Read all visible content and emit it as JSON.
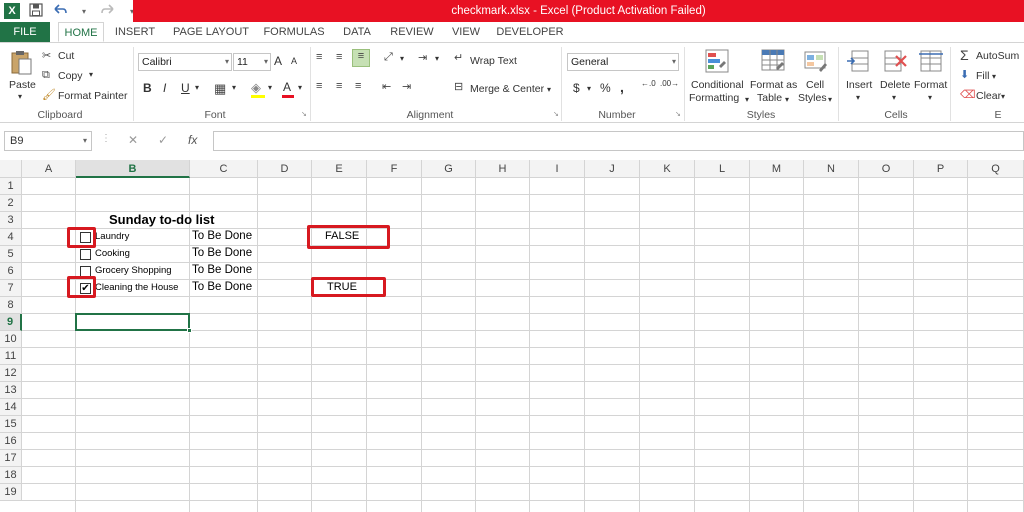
{
  "window": {
    "title": "checkmark.xlsx -  Excel (Product Activation Failed)",
    "accent": "#217346",
    "titlebar_color": "#e81123"
  },
  "qat": {
    "app_icon": "X",
    "save_icon": "save-icon",
    "undo_icon": "undo-icon",
    "redo_icon": "redo-icon",
    "customize_icon": "customize-icon"
  },
  "tabs": [
    "FILE",
    "HOME",
    "INSERT",
    "PAGE LAYOUT",
    "FORMULAS",
    "DATA",
    "REVIEW",
    "VIEW",
    "DEVELOPER"
  ],
  "ribbon": {
    "clipboard": {
      "paste": "Paste",
      "cut": "Cut",
      "copy": "Copy",
      "format_painter": "Format Painter",
      "label": "Clipboard"
    },
    "font": {
      "name": "Calibri",
      "size": "11",
      "bold": "B",
      "italic": "I",
      "underline": "U",
      "grow": "A",
      "shrink": "A",
      "color": "A",
      "label": "Font"
    },
    "alignment": {
      "wrap_text": "Wrap Text",
      "merge_center": "Merge & Center",
      "label": "Alignment"
    },
    "number": {
      "format": "General",
      "currency": "$",
      "percent": "%",
      "comma": ",",
      "inc_decimal": "←.0",
      "dec_decimal": ".00→",
      "label": "Number"
    },
    "styles": {
      "conditional_1": "Conditional",
      "conditional_2": "Formatting",
      "format_table_1": "Format as",
      "format_table_2": "Table",
      "cell_styles_1": "Cell",
      "cell_styles_2": "Styles",
      "label": "Styles"
    },
    "cells": {
      "insert": "Insert",
      "delete": "Delete",
      "format": "Format",
      "label": "Cells"
    },
    "editing": {
      "autosum": "AutoSum",
      "fill": "Fill",
      "clear": "Clear",
      "label": "E"
    }
  },
  "formula_bar": {
    "name_box": "B9",
    "cancel": "✕",
    "enter": "✓",
    "fx": "fx",
    "value": ""
  },
  "columns": [
    "A",
    "B",
    "C",
    "D",
    "E",
    "F",
    "G",
    "H",
    "I",
    "J",
    "K",
    "L",
    "M",
    "N",
    "O",
    "P",
    "Q"
  ],
  "rows": [
    "1",
    "2",
    "3",
    "4",
    "5",
    "6",
    "7",
    "8",
    "9",
    "10",
    "11",
    "12",
    "13",
    "14",
    "15",
    "16",
    "17",
    "18",
    "19"
  ],
  "sheet": {
    "title": "Sunday to-do list",
    "tasks": [
      {
        "label": "Laundry",
        "status": "To Be Done",
        "checked": false
      },
      {
        "label": "Cooking",
        "status": "To Be Done",
        "checked": false
      },
      {
        "label": "Grocery Shopping",
        "status": "To Be Done",
        "checked": false
      },
      {
        "label": "Cleaning the House",
        "status": "To Be Done",
        "checked": true
      }
    ],
    "linked_e4": "FALSE",
    "linked_e7": "TRUE",
    "check_glyph": "✔",
    "highlight_color": "#d71920"
  }
}
